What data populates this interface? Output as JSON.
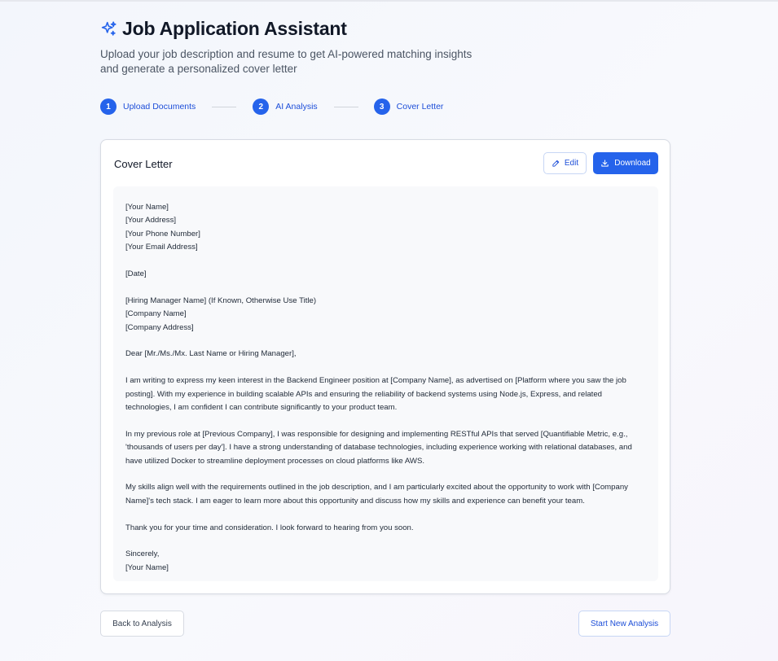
{
  "header": {
    "title": "Job Application Assistant",
    "subtitle": "Upload your job description and resume to get AI-powered matching insights and generate a personalized cover letter",
    "icon": "sparkles-icon"
  },
  "stepper": {
    "steps": [
      {
        "number": "1",
        "label": "Upload Documents"
      },
      {
        "number": "2",
        "label": "AI Analysis"
      },
      {
        "number": "3",
        "label": "Cover Letter"
      }
    ]
  },
  "card": {
    "title": "Cover Letter",
    "edit_label": "Edit",
    "download_label": "Download"
  },
  "letter": {
    "paragraphs": [
      "[Your Name]\n[Your Address]\n[Your Phone Number]\n[Your Email Address]",
      "[Date]",
      "[Hiring Manager Name] (If Known, Otherwise Use Title)\n[Company Name]\n[Company Address]",
      "Dear [Mr./Ms./Mx. Last Name or Hiring Manager],",
      "I am writing to express my keen interest in the Backend Engineer position at [Company Name], as advertised on [Platform where you saw the job posting]. With my experience in building scalable APIs and ensuring the reliability of backend systems using Node.js, Express, and related technologies, I am confident I can contribute significantly to your product team.",
      "In my previous role at [Previous Company], I was responsible for designing and implementing RESTful APIs that served [Quantifiable Metric, e.g., 'thousands of users per day']. I have a strong understanding of database technologies, including experience working with relational databases, and have utilized Docker to streamline deployment processes on cloud platforms like AWS.",
      "My skills align well with the requirements outlined in the job description, and I am particularly excited about the opportunity to work with [Company Name]'s tech stack. I am eager to learn more about this opportunity and discuss how my skills and experience can benefit your team.",
      "Thank you for your time and consideration. I look forward to hearing from you soon.",
      "Sincerely,\n[Your Name]"
    ]
  },
  "footer": {
    "back_label": "Back to Analysis",
    "new_label": "Start New Analysis"
  },
  "colors": {
    "accent": "#2563eb",
    "accent_text": "#1d4ed8"
  }
}
